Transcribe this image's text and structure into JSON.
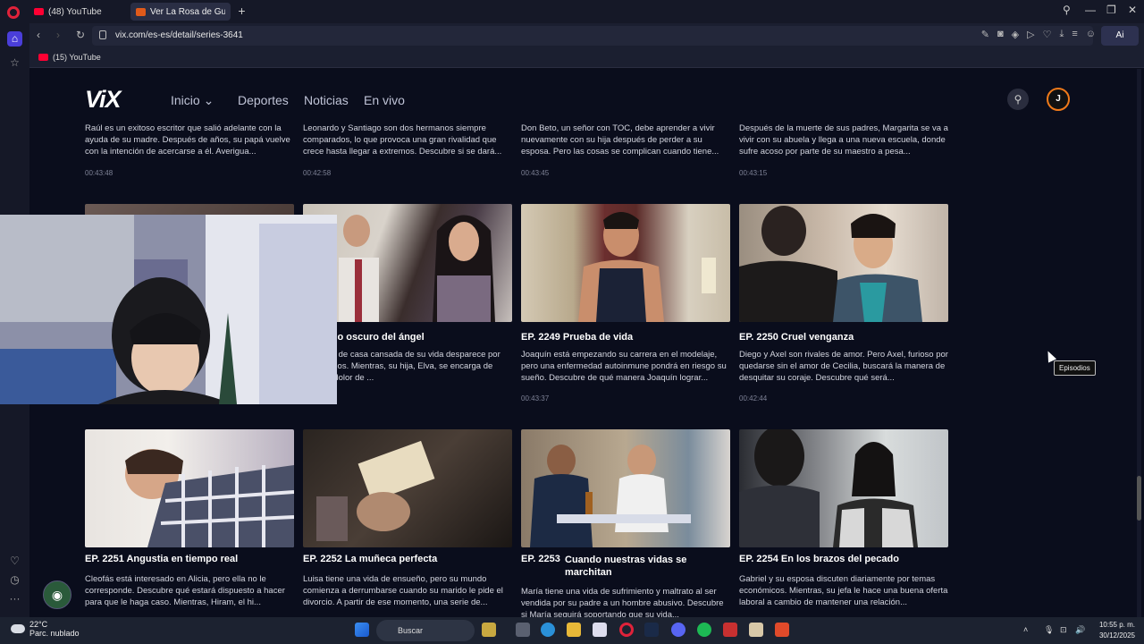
{
  "browser": {
    "tabs": [
      {
        "label": "(48) YouTube"
      },
      {
        "label": "Ver La Rosa de Guadalupe"
      }
    ],
    "new_tab": "+",
    "url": "vix.com/es-es/detail/series-3641",
    "ai_label": "Ai",
    "bookmark": "(15) YouTube",
    "window_controls": [
      "search-icon",
      "minimize-icon",
      "restore-icon",
      "close-icon"
    ]
  },
  "vix": {
    "logo": "ViX",
    "nav": [
      {
        "label": "Inicio"
      },
      {
        "label": "Deportes"
      },
      {
        "label": "Noticias"
      },
      {
        "label": "En vivo"
      }
    ],
    "avatar_initial": "J",
    "tooltip": "Episodios"
  },
  "row_top": [
    {
      "desc": "Raúl es un exitoso escritor que salió adelante con la ayuda de su madre. Después de años, su papá vuelve con la intención de acercarse a él. Averigua...",
      "duration": "00:43:48"
    },
    {
      "desc": "Leonardo y Santiago son dos hermanos siempre comparados, lo que provoca una gran rivalidad que crece hasta llegar a extremos. Descubre si se dará...",
      "duration": "00:42:58"
    },
    {
      "desc": "Don Beto, un señor con TOC, debe aprender a vivir nuevamente con su hija después de perder a su esposa. Pero las cosas se complican cuando tiene...",
      "duration": "00:43:45"
    },
    {
      "desc": "Después de la muerte de sus padres, Margarita se va a vivir con su abuela y llega a una nueva escuela, donde sufre acoso por parte de su maestro a pesa...",
      "duration": "00:43:15"
    }
  ],
  "row_mid": [
    {
      "title": "",
      "desc": "",
      "duration": ""
    },
    {
      "title": "7  El lado oscuro del ángel",
      "desc": "una ama de casa cansada de su vida desparece por varios años. Mientras, su hija, Elva, se encarga de curar el dolor de ...",
      "duration": ""
    },
    {
      "title": "EP. 2249  Prueba de vida",
      "desc": "Joaquín está empezando su carrera en el modelaje, pero una enfermedad autoinmune pondrá en riesgo su sueño. Descubre de qué manera Joaquín lograr...",
      "duration": "00:43:37"
    },
    {
      "title": "EP. 2250  Cruel venganza",
      "desc": "Diego y Axel son rivales de amor. Pero Axel, furioso por quedarse sin el amor de Cecilia, buscará la manera de desquitar su coraje. Descubre qué será...",
      "duration": "00:42:44"
    }
  ],
  "row_bottom": [
    {
      "title": "EP. 2251  Angustia en tiempo real",
      "desc": "Cleofás está interesado en Alicia, pero ella no le corresponde. Descubre qué estará dispuesto a hacer para que le haga caso. Mientras, Hiram, el hi..."
    },
    {
      "title": "EP. 2252  La muñeca perfecta",
      "desc": "Luisa tiene una vida de ensueño, pero su mundo comienza a derrumbarse cuando su marido le pide el divorcio. A partir de ese momento, una serie de..."
    },
    {
      "title": "EP. 2253",
      "title2": "Cuando nuestras vidas se marchitan",
      "desc": "María tiene una vida de sufrimiento y maltrato al ser vendida por su padre a un hombre abusivo. Descubre si María seguirá soportando que su vida..."
    },
    {
      "title": "EP. 2254  En los brazos del pecado",
      "desc": "Gabriel y su esposa discuten diariamente por temas económicos. Mientras, su jefa le hace una buena oferta laboral a cambio de mantener una relación..."
    }
  ],
  "taskbar": {
    "temp": "22°C",
    "weather": "Parc. nublado",
    "search": "Buscar",
    "time": "10:55 p. m.",
    "date": "30/12/2025"
  }
}
